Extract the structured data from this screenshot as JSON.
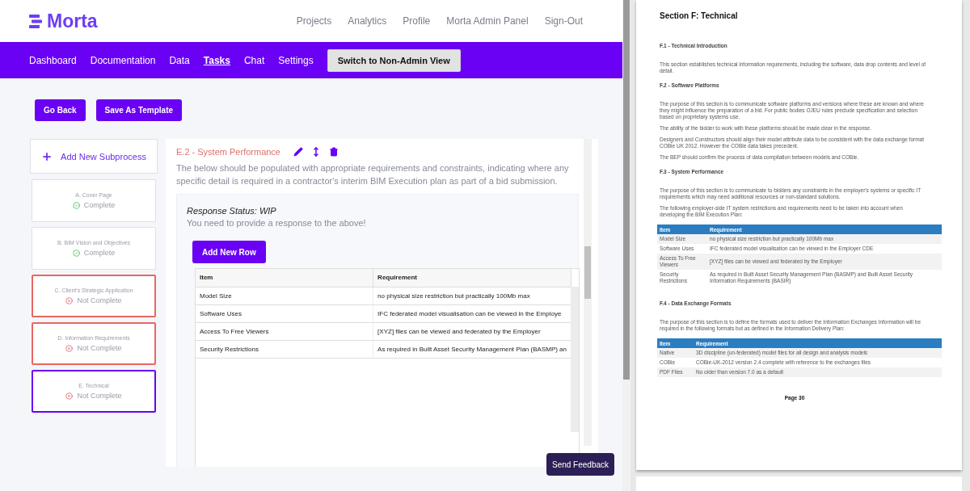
{
  "header": {
    "logo": "Morta",
    "links": [
      "Projects",
      "Analytics",
      "Profile",
      "Morta Admin Panel",
      "Sign-Out"
    ]
  },
  "nav": {
    "tabs": [
      {
        "label": "Dashboard",
        "selected": false
      },
      {
        "label": "Documentation",
        "selected": false
      },
      {
        "label": "Data",
        "selected": false
      },
      {
        "label": "Tasks",
        "selected": true
      },
      {
        "label": "Chat",
        "selected": false
      },
      {
        "label": "Settings",
        "selected": false
      }
    ],
    "switch_button": "Switch to Non-Admin View"
  },
  "actions": [
    "Go Back",
    "Save As Template"
  ],
  "sidebar": {
    "add_button": "Add New Subprocess",
    "items": [
      {
        "title": "A. Cover Page",
        "kind": "complete",
        "status_label": "Complete",
        "selected": false
      },
      {
        "title": "B. BIM Vision and Objectives",
        "kind": "complete",
        "status_label": "Complete",
        "selected": false
      },
      {
        "title": "C. Client's Strategic Application",
        "kind": "incomplete",
        "status_label": "Not Complete",
        "selected": false
      },
      {
        "title": "D. Information Requirements",
        "kind": "incomplete",
        "status_label": "Not Complete",
        "selected": false
      },
      {
        "title": "E. Technical",
        "kind": "incomplete",
        "status_label": "Not Complete",
        "selected": true
      }
    ]
  },
  "section": {
    "title": "E.2 - System Performance",
    "description": "The below should be populated with appropriate requirements and constraints, indicating where any specific detail is required in a contractor's interim BIM Execution plan as part of a bid submission.",
    "response_status": "Response Status: WIP",
    "response_note": "You need to provide a response to the above!",
    "add_row_button": "Add New Row",
    "table": {
      "columns": [
        "Item",
        "Requirement"
      ],
      "rows": [
        [
          "Model Size",
          "no physical size restriction but practically 100Mb max"
        ],
        [
          "Software Uses",
          "IFC federated model visualisation can be viewed in the Employe"
        ],
        [
          "Access To Free Viewers",
          "[XYZ] files can be viewed and federated by the Employer"
        ],
        [
          "Security Restrictions",
          "As required in Built Asset Security Management Plan (BASMP) an"
        ]
      ]
    }
  },
  "feedback_button": "Send Feedback",
  "document": {
    "title": "Section F: Technical",
    "blocks": [
      {
        "kind": "heading",
        "text": "F.1 - Technical Introduction"
      },
      {
        "kind": "paragraph",
        "text": "This section establishes technical information requirements, including the software, data drop contents and level of detail."
      },
      {
        "kind": "heading",
        "text": "F.2 - Software Platforms"
      },
      {
        "kind": "paragraph",
        "text": "The purpose of this section is to communicate software platforms and versions where these are known and where they might influence the preparation of a bid. For public bodies OJEU rules preclude specification and selection based on proprietary systems use."
      },
      {
        "kind": "paragraph",
        "text": "The ability of the bidder to work with these platforms should be made clear in the response."
      },
      {
        "kind": "paragraph",
        "text": "Designers and Constructors should align their model attribute data to be consistent with the data exchange format COBie UK 2012. However the COBie data takes precedent."
      },
      {
        "kind": "paragraph",
        "text": "The BEP should confirm the process of data compilation between models and COBie."
      },
      {
        "kind": "heading",
        "text": "F.3 - System Performance"
      },
      {
        "kind": "paragraph",
        "text": "The purpose of this section is to communicate to bidders any constraints in the employer's systems or specific IT requirements which may need additional resources or non-standard solutions."
      },
      {
        "kind": "paragraph",
        "text": "The following employer-side IT system restrictions and requirements need to be taken into account when developing the BIM Execution Plan:"
      },
      {
        "kind": "table",
        "columns": [
          "Item",
          "Requirement"
        ],
        "rows": [
          [
            "Model Size",
            "no physical size restriction but practically 100Mb max"
          ],
          [
            "Software Uses",
            "IFC federated model visualisation can be viewed in the Employer CDE"
          ],
          [
            "Access To Free Viewers",
            "[XYZ] files can be viewed and federated by the Employer"
          ],
          [
            "Security Restrictions",
            "As required in Built Asset Security Management Plan (BASMP) and Built Asset Security Information Requirements (BASIR)"
          ]
        ]
      },
      {
        "kind": "heading",
        "text": "F.4 - Data Exchange Formats"
      },
      {
        "kind": "paragraph",
        "text": "The purpose of this section is to define the formats used to deliver the Information Exchanges Information will be required in the following formats but as defined in the Information Delivery Plan:"
      },
      {
        "kind": "table",
        "columns": [
          "Item",
          "Requirement"
        ],
        "rows": [
          [
            "Native",
            "3D discipline (un-federated) model files for all design and analysis models"
          ],
          [
            "COBie",
            "COBie-UK-2012 version 2.4 complete with reference to the exchanges files"
          ],
          [
            "PDF Files",
            "No older than version 7.0 as a default"
          ]
        ]
      }
    ],
    "page_number": "Page 30"
  }
}
